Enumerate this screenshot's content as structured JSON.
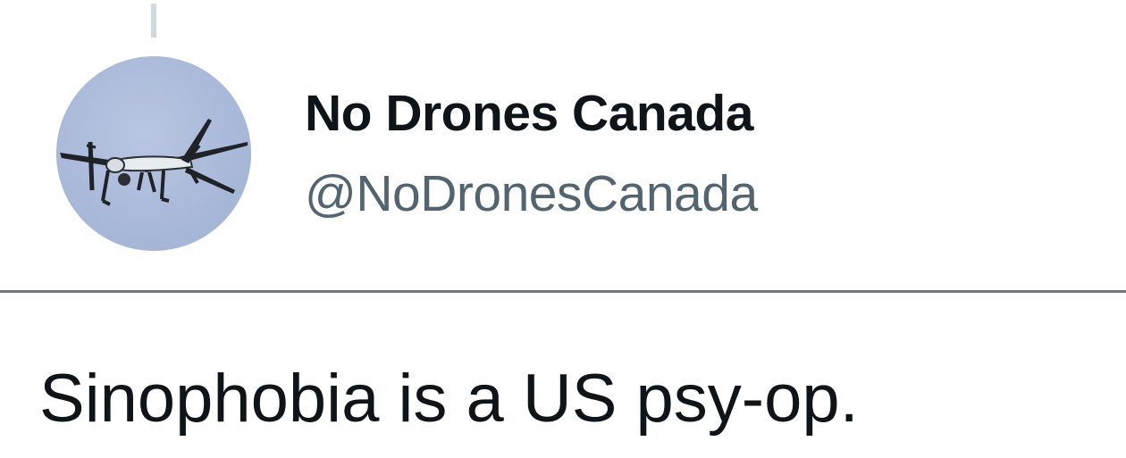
{
  "tweet": {
    "author": {
      "display_name": "No Drones Canada",
      "handle": "@NoDronesCanada",
      "avatar_icon": "drone-avatar-image"
    },
    "text": "Sinophobia is a US psy-op."
  },
  "colors": {
    "background": "#ffffff",
    "name_text": "#0f1419",
    "handle_text": "#536471",
    "divider": "#6e767d",
    "thread_line": "#cfd9de",
    "avatar_bg": "#a8b8d8"
  }
}
